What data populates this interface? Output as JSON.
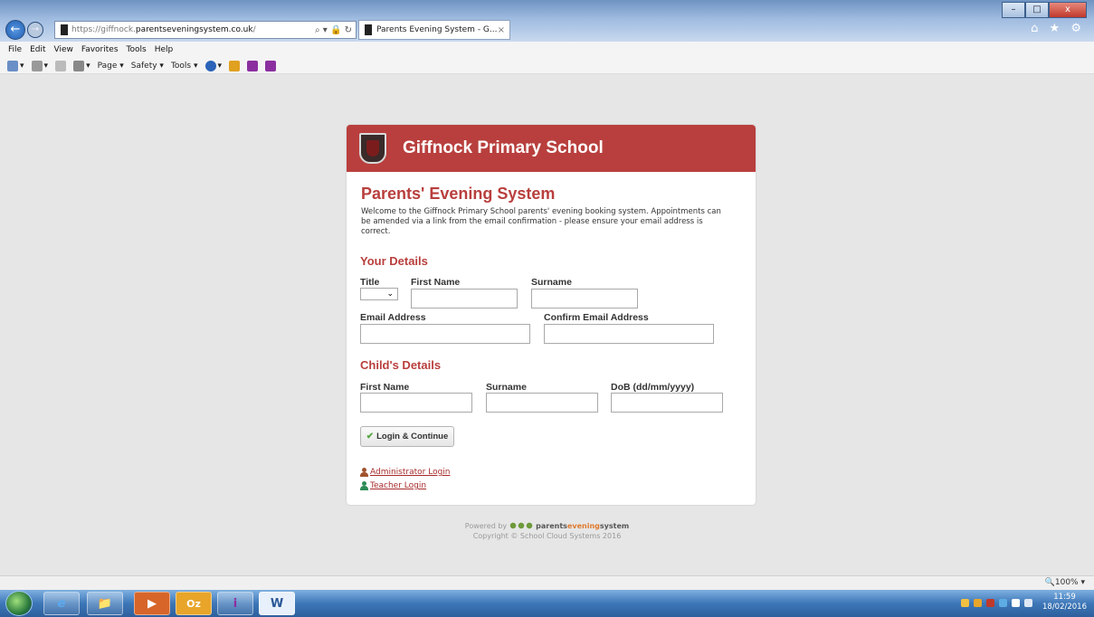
{
  "browser": {
    "url": "https://giffnock.parentseveningsystem.co.uk/",
    "url_display": {
      "prefix": "https://giffnock.",
      "domain": "parentseveningsystem.co.uk",
      "suffix": "/"
    },
    "address_tools": "⌕ ▾ 🔒 ↻",
    "tab_label": "Parents Evening System - G...",
    "tab_close": "×",
    "window_buttons": [
      "–",
      "□",
      "x"
    ],
    "right_icons": "⌂ ★ ⚙",
    "back_icon": "←",
    "forward_icon": "→",
    "menu": [
      "File",
      "Edit",
      "View",
      "Favorites",
      "Tools",
      "Help"
    ],
    "command_bar": [
      "▾",
      "▾",
      "▾",
      "Page ▾",
      "Safety ▾",
      "Tools ▾",
      "▾"
    ],
    "zoom": "🔍100%  ▾"
  },
  "page": {
    "school_name": "Giffnock Primary School",
    "app_title": "Parents' Evening System",
    "welcome": "Welcome to the Giffnock Primary School parents' evening booking system. Appointments can be amended via a link from the email confirmation - please ensure your email address is correct.",
    "your_details": {
      "heading": "Your Details",
      "title_label": "Title",
      "title_value": "",
      "first_name_label": "First Name",
      "surname_label": "Surname",
      "email_label": "Email Address",
      "confirm_email_label": "Confirm Email Address"
    },
    "child_details": {
      "heading": "Child's Details",
      "first_name_label": "First Name",
      "surname_label": "Surname",
      "dob_label": "DoB (dd/mm/yyyy)"
    },
    "login_button": "Login & Continue",
    "admin_login": "Administrator Login",
    "teacher_login": "Teacher Login",
    "footer": {
      "powered_by": "Powered by",
      "brand_a": "parents",
      "brand_b": "evening",
      "brand_c": "system",
      "copyright": "Copyright © School Cloud Systems 2016"
    }
  },
  "taskbar": {
    "apps": [
      "e",
      "📁",
      "▶",
      "Oz",
      "i",
      "W"
    ],
    "time": "11:59",
    "date": "18/02/2016"
  },
  "colors": {
    "accent": "#b83f3d",
    "link": "#a72c2c"
  }
}
